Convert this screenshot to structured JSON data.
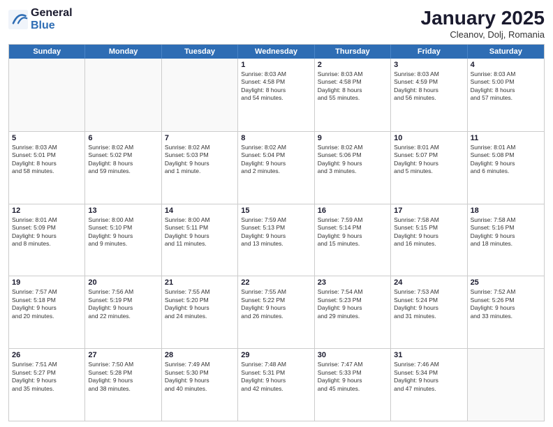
{
  "logo": {
    "line1": "General",
    "line2": "Blue"
  },
  "title": "January 2025",
  "location": "Cleanov, Dolj, Romania",
  "header": {
    "days": [
      "Sunday",
      "Monday",
      "Tuesday",
      "Wednesday",
      "Thursday",
      "Friday",
      "Saturday"
    ]
  },
  "weeks": [
    [
      {
        "date": "",
        "info": ""
      },
      {
        "date": "",
        "info": ""
      },
      {
        "date": "",
        "info": ""
      },
      {
        "date": "1",
        "info": "Sunrise: 8:03 AM\nSunset: 4:58 PM\nDaylight: 8 hours\nand 54 minutes."
      },
      {
        "date": "2",
        "info": "Sunrise: 8:03 AM\nSunset: 4:58 PM\nDaylight: 8 hours\nand 55 minutes."
      },
      {
        "date": "3",
        "info": "Sunrise: 8:03 AM\nSunset: 4:59 PM\nDaylight: 8 hours\nand 56 minutes."
      },
      {
        "date": "4",
        "info": "Sunrise: 8:03 AM\nSunset: 5:00 PM\nDaylight: 8 hours\nand 57 minutes."
      }
    ],
    [
      {
        "date": "5",
        "info": "Sunrise: 8:03 AM\nSunset: 5:01 PM\nDaylight: 8 hours\nand 58 minutes."
      },
      {
        "date": "6",
        "info": "Sunrise: 8:02 AM\nSunset: 5:02 PM\nDaylight: 8 hours\nand 59 minutes."
      },
      {
        "date": "7",
        "info": "Sunrise: 8:02 AM\nSunset: 5:03 PM\nDaylight: 9 hours\nand 1 minute."
      },
      {
        "date": "8",
        "info": "Sunrise: 8:02 AM\nSunset: 5:04 PM\nDaylight: 9 hours\nand 2 minutes."
      },
      {
        "date": "9",
        "info": "Sunrise: 8:02 AM\nSunset: 5:06 PM\nDaylight: 9 hours\nand 3 minutes."
      },
      {
        "date": "10",
        "info": "Sunrise: 8:01 AM\nSunset: 5:07 PM\nDaylight: 9 hours\nand 5 minutes."
      },
      {
        "date": "11",
        "info": "Sunrise: 8:01 AM\nSunset: 5:08 PM\nDaylight: 9 hours\nand 6 minutes."
      }
    ],
    [
      {
        "date": "12",
        "info": "Sunrise: 8:01 AM\nSunset: 5:09 PM\nDaylight: 9 hours\nand 8 minutes."
      },
      {
        "date": "13",
        "info": "Sunrise: 8:00 AM\nSunset: 5:10 PM\nDaylight: 9 hours\nand 9 minutes."
      },
      {
        "date": "14",
        "info": "Sunrise: 8:00 AM\nSunset: 5:11 PM\nDaylight: 9 hours\nand 11 minutes."
      },
      {
        "date": "15",
        "info": "Sunrise: 7:59 AM\nSunset: 5:13 PM\nDaylight: 9 hours\nand 13 minutes."
      },
      {
        "date": "16",
        "info": "Sunrise: 7:59 AM\nSunset: 5:14 PM\nDaylight: 9 hours\nand 15 minutes."
      },
      {
        "date": "17",
        "info": "Sunrise: 7:58 AM\nSunset: 5:15 PM\nDaylight: 9 hours\nand 16 minutes."
      },
      {
        "date": "18",
        "info": "Sunrise: 7:58 AM\nSunset: 5:16 PM\nDaylight: 9 hours\nand 18 minutes."
      }
    ],
    [
      {
        "date": "19",
        "info": "Sunrise: 7:57 AM\nSunset: 5:18 PM\nDaylight: 9 hours\nand 20 minutes."
      },
      {
        "date": "20",
        "info": "Sunrise: 7:56 AM\nSunset: 5:19 PM\nDaylight: 9 hours\nand 22 minutes."
      },
      {
        "date": "21",
        "info": "Sunrise: 7:55 AM\nSunset: 5:20 PM\nDaylight: 9 hours\nand 24 minutes."
      },
      {
        "date": "22",
        "info": "Sunrise: 7:55 AM\nSunset: 5:22 PM\nDaylight: 9 hours\nand 26 minutes."
      },
      {
        "date": "23",
        "info": "Sunrise: 7:54 AM\nSunset: 5:23 PM\nDaylight: 9 hours\nand 29 minutes."
      },
      {
        "date": "24",
        "info": "Sunrise: 7:53 AM\nSunset: 5:24 PM\nDaylight: 9 hours\nand 31 minutes."
      },
      {
        "date": "25",
        "info": "Sunrise: 7:52 AM\nSunset: 5:26 PM\nDaylight: 9 hours\nand 33 minutes."
      }
    ],
    [
      {
        "date": "26",
        "info": "Sunrise: 7:51 AM\nSunset: 5:27 PM\nDaylight: 9 hours\nand 35 minutes."
      },
      {
        "date": "27",
        "info": "Sunrise: 7:50 AM\nSunset: 5:28 PM\nDaylight: 9 hours\nand 38 minutes."
      },
      {
        "date": "28",
        "info": "Sunrise: 7:49 AM\nSunset: 5:30 PM\nDaylight: 9 hours\nand 40 minutes."
      },
      {
        "date": "29",
        "info": "Sunrise: 7:48 AM\nSunset: 5:31 PM\nDaylight: 9 hours\nand 42 minutes."
      },
      {
        "date": "30",
        "info": "Sunrise: 7:47 AM\nSunset: 5:33 PM\nDaylight: 9 hours\nand 45 minutes."
      },
      {
        "date": "31",
        "info": "Sunrise: 7:46 AM\nSunset: 5:34 PM\nDaylight: 9 hours\nand 47 minutes."
      },
      {
        "date": "",
        "info": ""
      }
    ]
  ]
}
